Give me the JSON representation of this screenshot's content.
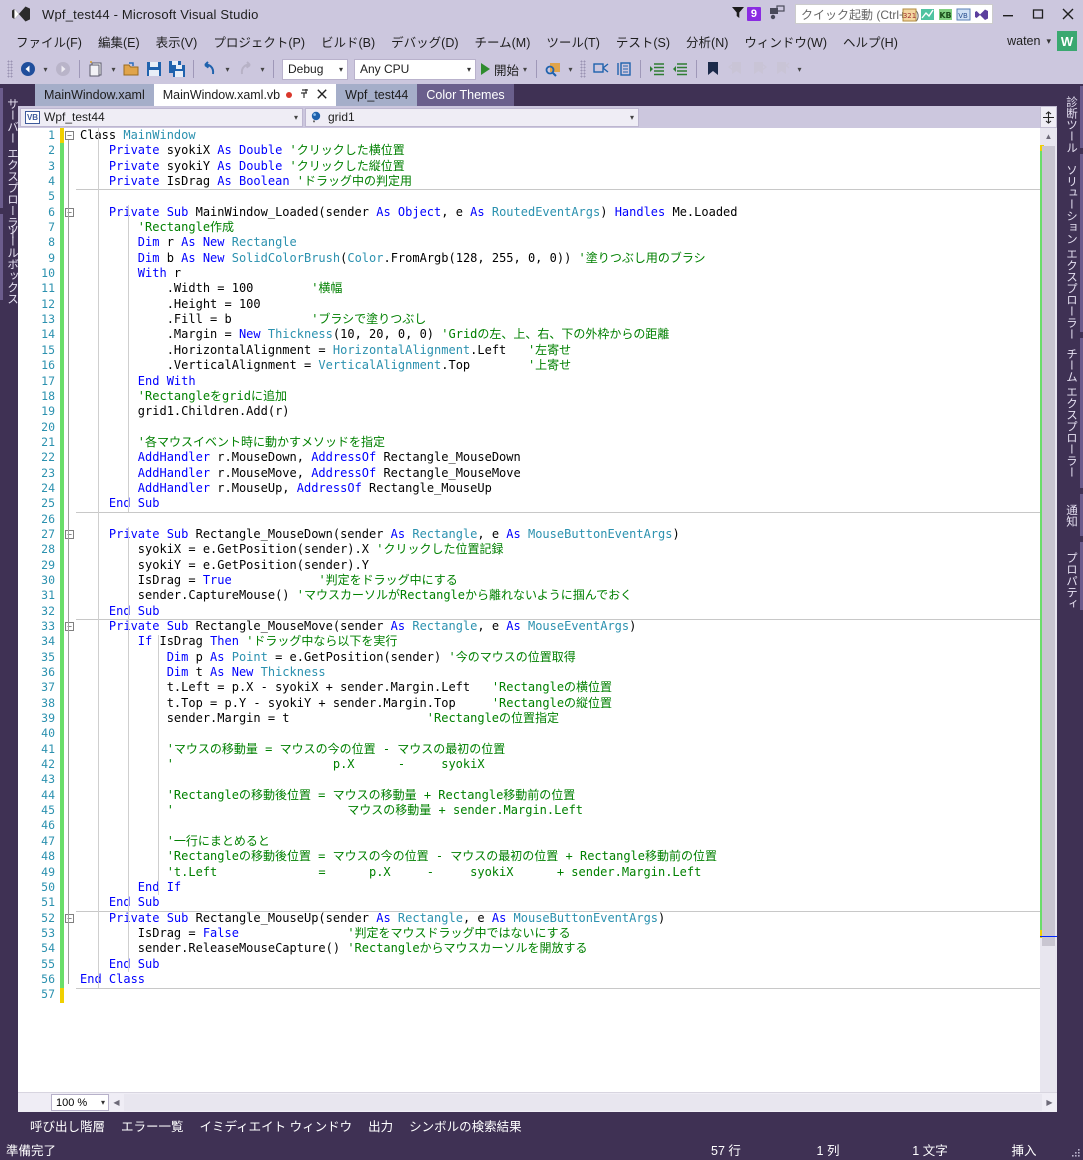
{
  "window": {
    "title": "Wpf_test44 - Microsoft Visual Studio",
    "logo_icon": "visual-studio-logo-icon",
    "minimize_icon": "minimize-icon",
    "maximize_icon": "maximize-icon",
    "close_icon": "close-icon"
  },
  "titlebar_right": {
    "notification_icon": "bell-filter-icon",
    "notification_count": "9",
    "feedback_icon": "feedback-icon",
    "quicklaunch_placeholder": "クイック起動 (Ctrl+Q)",
    "ql_icon_1": "calendar-icon",
    "ql_icon_2": "chart-icon",
    "ql_icon_3": "kb-icon",
    "ql_icon_4": "vb-icon",
    "ql_icon_5": "vs-icon"
  },
  "menu": {
    "items": [
      {
        "label": "ファイル(F)"
      },
      {
        "label": "編集(E)"
      },
      {
        "label": "表示(V)"
      },
      {
        "label": "プロジェクト(P)"
      },
      {
        "label": "ビルド(B)"
      },
      {
        "label": "デバッグ(D)"
      },
      {
        "label": "チーム(M)"
      },
      {
        "label": "ツール(T)"
      },
      {
        "label": "テスト(S)"
      },
      {
        "label": "分析(N)"
      },
      {
        "label": "ウィンドウ(W)"
      },
      {
        "label": "ヘルプ(H)"
      }
    ],
    "user_name": "waten",
    "user_caret": "▾",
    "user_avatar_letter": "W"
  },
  "toolbar": {
    "back_icon": "navigate-back-icon",
    "forward_icon": "navigate-forward-icon",
    "new_project_icon": "new-project-icon",
    "open_icon": "open-file-icon",
    "save_icon": "save-icon",
    "save_all_icon": "save-all-icon",
    "undo_icon": "undo-icon",
    "redo_icon": "redo-icon",
    "config_value": "Debug",
    "platform_value": "Any CPU",
    "start_label": "開始",
    "start_icon": "play-icon",
    "find_icon": "find-in-files-icon",
    "comment_icon": "comment-selection-icon",
    "uncomment_icon": "uncomment-selection-icon",
    "indent_icon": "increase-indent-icon",
    "outdent_icon": "decrease-indent-icon",
    "bookmark_icon": "bookmark-icon",
    "prev_bookmark_icon": "previous-bookmark-icon",
    "next_bookmark_icon": "next-bookmark-icon",
    "clear_bookmark_icon": "clear-bookmark-icon",
    "overflow_icon": "toolbar-overflow-icon",
    "caret": "▾"
  },
  "left_tool_tabs": [
    {
      "label": "サーバー エクスプローラー"
    },
    {
      "label": "ツールボックス"
    }
  ],
  "right_tool_tabs": [
    {
      "label": "診断ツール"
    },
    {
      "label": "ソリューション エクスプローラー"
    },
    {
      "label": "チーム エクスプローラー"
    },
    {
      "label": "通知"
    },
    {
      "label": "プロパティ"
    }
  ],
  "doc_tabs": [
    {
      "label": "MainWindow.xaml",
      "state": "inactive"
    },
    {
      "label": "MainWindow.xaml.vb",
      "state": "active",
      "dirty": true,
      "pin_icon": "pin-icon",
      "close_icon": "tab-close-icon"
    },
    {
      "label": "Wpf_test44",
      "state": "inactive"
    },
    {
      "label": "Color Themes",
      "state": "preview"
    }
  ],
  "navbar": {
    "type_icon": "vb-class-icon",
    "type_value": "Wpf_test44",
    "member_icon": "field-icon",
    "member_value": "grid1",
    "caret": "▾"
  },
  "editor": {
    "zoom": "100 %",
    "zoom_caret": "▾",
    "splitter_icon": "split-view-icon",
    "scroll_up_icon": "scroll-up-icon",
    "scroll_left_icon": "scroll-left-icon",
    "scroll_right_icon": "scroll-right-icon",
    "language": "vb",
    "lines": [
      {
        "n": 1,
        "t": [
          [
            "pl",
            "Class "
          ],
          [
            "ty",
            "MainWindow"
          ]
        ],
        "indent": 0
      },
      {
        "n": 2,
        "t": [
          [
            "kw",
            "    Private "
          ],
          [
            "pl",
            "syokiX "
          ],
          [
            "kw",
            "As "
          ],
          [
            "kw",
            "Double "
          ],
          [
            "cm",
            "'クリックした横位置"
          ]
        ]
      },
      {
        "n": 3,
        "t": [
          [
            "kw",
            "    Private "
          ],
          [
            "pl",
            "syokiY "
          ],
          [
            "kw",
            "As "
          ],
          [
            "kw",
            "Double "
          ],
          [
            "cm",
            "'クリックした縦位置"
          ]
        ]
      },
      {
        "n": 4,
        "t": [
          [
            "kw",
            "    Private "
          ],
          [
            "pl",
            "IsDrag "
          ],
          [
            "kw",
            "As "
          ],
          [
            "kw",
            "Boolean "
          ],
          [
            "cm",
            "'ドラッグ中の判定用"
          ]
        ]
      },
      {
        "n": 5,
        "t": []
      },
      {
        "n": 6,
        "t": [
          [
            "kw",
            "    Private Sub "
          ],
          [
            "pl",
            "MainWindow_Loaded(sender "
          ],
          [
            "kw",
            "As "
          ],
          [
            "kw",
            "Object"
          ],
          [
            "pl",
            ", e "
          ],
          [
            "kw",
            "As "
          ],
          [
            "ty",
            "RoutedEventArgs"
          ],
          [
            "pl",
            ") "
          ],
          [
            "kw",
            "Handles "
          ],
          [
            "pl",
            "Me.Loaded"
          ]
        ]
      },
      {
        "n": 7,
        "t": [
          [
            "cm",
            "        'Rectangle作成"
          ]
        ]
      },
      {
        "n": 8,
        "t": [
          [
            "kw",
            "        Dim "
          ],
          [
            "pl",
            "r "
          ],
          [
            "kw",
            "As New "
          ],
          [
            "ty",
            "Rectangle"
          ]
        ]
      },
      {
        "n": 9,
        "t": [
          [
            "kw",
            "        Dim "
          ],
          [
            "pl",
            "b "
          ],
          [
            "kw",
            "As New "
          ],
          [
            "ty",
            "SolidColorBrush"
          ],
          [
            "pl",
            "("
          ],
          [
            "ty",
            "Color"
          ],
          [
            "pl",
            ".FromArgb(128, 255, 0, 0)) "
          ],
          [
            "cm",
            "'塗りつぶし用のブラシ"
          ]
        ]
      },
      {
        "n": 10,
        "t": [
          [
            "kw",
            "        With "
          ],
          [
            "pl",
            "r"
          ]
        ]
      },
      {
        "n": 11,
        "t": [
          [
            "pl",
            "            .Width = 100        "
          ],
          [
            "cm",
            "'横幅"
          ]
        ]
      },
      {
        "n": 12,
        "t": [
          [
            "pl",
            "            .Height = 100"
          ]
        ]
      },
      {
        "n": 13,
        "t": [
          [
            "pl",
            "            .Fill = b           "
          ],
          [
            "cm",
            "'ブラシで塗りつぶし"
          ]
        ]
      },
      {
        "n": 14,
        "t": [
          [
            "pl",
            "            .Margin = "
          ],
          [
            "kw",
            "New "
          ],
          [
            "ty",
            "Thickness"
          ],
          [
            "pl",
            "(10, 20, 0, 0) "
          ],
          [
            "cm",
            "'Gridの左、上、右、下の外枠からの距離"
          ]
        ]
      },
      {
        "n": 15,
        "t": [
          [
            "pl",
            "            .HorizontalAlignment = "
          ],
          [
            "ty",
            "HorizontalAlignment"
          ],
          [
            "pl",
            ".Left   "
          ],
          [
            "cm",
            "'左寄せ"
          ]
        ]
      },
      {
        "n": 16,
        "t": [
          [
            "pl",
            "            .VerticalAlignment = "
          ],
          [
            "ty",
            "VerticalAlignment"
          ],
          [
            "pl",
            ".Top        "
          ],
          [
            "cm",
            "'上寄せ"
          ]
        ]
      },
      {
        "n": 17,
        "t": [
          [
            "kw",
            "        End With"
          ]
        ]
      },
      {
        "n": 18,
        "t": [
          [
            "cm",
            "        'Rectangleをgridに追加"
          ]
        ]
      },
      {
        "n": 19,
        "t": [
          [
            "pl",
            "        grid1.Children.Add(r)"
          ]
        ]
      },
      {
        "n": 20,
        "t": []
      },
      {
        "n": 21,
        "t": [
          [
            "cm",
            "        '各マウスイベント時に動かすメソッドを指定"
          ]
        ]
      },
      {
        "n": 22,
        "t": [
          [
            "kw",
            "        AddHandler "
          ],
          [
            "pl",
            "r.MouseDown, "
          ],
          [
            "kw",
            "AddressOf "
          ],
          [
            "pl",
            "Rectangle_MouseDown"
          ]
        ]
      },
      {
        "n": 23,
        "t": [
          [
            "kw",
            "        AddHandler "
          ],
          [
            "pl",
            "r.MouseMove, "
          ],
          [
            "kw",
            "AddressOf "
          ],
          [
            "pl",
            "Rectangle_MouseMove"
          ]
        ]
      },
      {
        "n": 24,
        "t": [
          [
            "kw",
            "        AddHandler "
          ],
          [
            "pl",
            "r.MouseUp, "
          ],
          [
            "kw",
            "AddressOf "
          ],
          [
            "pl",
            "Rectangle_MouseUp"
          ]
        ]
      },
      {
        "n": 25,
        "t": [
          [
            "kw",
            "    End Sub"
          ]
        ]
      },
      {
        "n": 26,
        "t": []
      },
      {
        "n": 27,
        "t": [
          [
            "kw",
            "    Private Sub "
          ],
          [
            "pl",
            "Rectangle_MouseDown(sender "
          ],
          [
            "kw",
            "As "
          ],
          [
            "ty",
            "Rectangle"
          ],
          [
            "pl",
            ", e "
          ],
          [
            "kw",
            "As "
          ],
          [
            "ty",
            "MouseButtonEventArgs"
          ],
          [
            "pl",
            ")"
          ]
        ]
      },
      {
        "n": 28,
        "t": [
          [
            "pl",
            "        syokiX = e.GetPosition(sender).X "
          ],
          [
            "cm",
            "'クリックした位置記録"
          ]
        ]
      },
      {
        "n": 29,
        "t": [
          [
            "pl",
            "        syokiY = e.GetPosition(sender).Y"
          ]
        ]
      },
      {
        "n": 30,
        "t": [
          [
            "pl",
            "        IsDrag = "
          ],
          [
            "kw",
            "True"
          ],
          [
            "pl",
            "            "
          ],
          [
            "cm",
            "'判定をドラッグ中にする"
          ]
        ]
      },
      {
        "n": 31,
        "t": [
          [
            "pl",
            "        sender.CaptureMouse() "
          ],
          [
            "cm",
            "'マウスカーソルがRectangleから離れないように掴んでおく"
          ]
        ]
      },
      {
        "n": 32,
        "t": [
          [
            "kw",
            "    End Sub"
          ]
        ]
      },
      {
        "n": 33,
        "t": [
          [
            "kw",
            "    Private Sub "
          ],
          [
            "pl",
            "Rectangle_MouseMove(sender "
          ],
          [
            "kw",
            "As "
          ],
          [
            "ty",
            "Rectangle"
          ],
          [
            "pl",
            ", e "
          ],
          [
            "kw",
            "As "
          ],
          [
            "ty",
            "MouseEventArgs"
          ],
          [
            "pl",
            ")"
          ]
        ]
      },
      {
        "n": 34,
        "t": [
          [
            "kw",
            "        If "
          ],
          [
            "pl",
            "IsDrag "
          ],
          [
            "kw",
            "Then "
          ],
          [
            "cm",
            "'ドラッグ中なら以下を実行"
          ]
        ]
      },
      {
        "n": 35,
        "t": [
          [
            "kw",
            "            Dim "
          ],
          [
            "pl",
            "p "
          ],
          [
            "kw",
            "As "
          ],
          [
            "ty",
            "Point"
          ],
          [
            "pl",
            " = e.GetPosition(sender) "
          ],
          [
            "cm",
            "'今のマウスの位置取得"
          ]
        ]
      },
      {
        "n": 36,
        "t": [
          [
            "kw",
            "            Dim "
          ],
          [
            "pl",
            "t "
          ],
          [
            "kw",
            "As New "
          ],
          [
            "ty",
            "Thickness"
          ]
        ]
      },
      {
        "n": 37,
        "t": [
          [
            "pl",
            "            t.Left = p.X - syokiX + sender.Margin.Left   "
          ],
          [
            "cm",
            "'Rectangleの横位置"
          ]
        ]
      },
      {
        "n": 38,
        "t": [
          [
            "pl",
            "            t.Top = p.Y - syokiY + sender.Margin.Top     "
          ],
          [
            "cm",
            "'Rectangleの縦位置"
          ]
        ]
      },
      {
        "n": 39,
        "t": [
          [
            "pl",
            "            sender.Margin = t                   "
          ],
          [
            "cm",
            "'Rectangleの位置指定"
          ]
        ]
      },
      {
        "n": 40,
        "t": []
      },
      {
        "n": 41,
        "t": [
          [
            "cm",
            "            'マウスの移動量 = マウスの今の位置 - マウスの最初の位置"
          ]
        ]
      },
      {
        "n": 42,
        "t": [
          [
            "cm",
            "            '                      p.X      -     syokiX"
          ]
        ]
      },
      {
        "n": 43,
        "t": []
      },
      {
        "n": 44,
        "t": [
          [
            "cm",
            "            'Rectangleの移動後位置 = マウスの移動量 + Rectangle移動前の位置"
          ]
        ]
      },
      {
        "n": 45,
        "t": [
          [
            "cm",
            "            '                        マウスの移動量 + sender.Margin.Left"
          ]
        ]
      },
      {
        "n": 46,
        "t": []
      },
      {
        "n": 47,
        "t": [
          [
            "cm",
            "            '一行にまとめると"
          ]
        ]
      },
      {
        "n": 48,
        "t": [
          [
            "cm",
            "            'Rectangleの移動後位置 = マウスの今の位置 - マウスの最初の位置 + Rectangle移動前の位置"
          ]
        ]
      },
      {
        "n": 49,
        "t": [
          [
            "cm",
            "            't.Left              =      p.X     -     syokiX      + sender.Margin.Left"
          ]
        ]
      },
      {
        "n": 50,
        "t": [
          [
            "kw",
            "        End If"
          ]
        ]
      },
      {
        "n": 51,
        "t": [
          [
            "kw",
            "    End Sub"
          ]
        ]
      },
      {
        "n": 52,
        "t": [
          [
            "kw",
            "    Private Sub "
          ],
          [
            "pl",
            "Rectangle_MouseUp(sender "
          ],
          [
            "kw",
            "As "
          ],
          [
            "ty",
            "Rectangle"
          ],
          [
            "pl",
            ", e "
          ],
          [
            "kw",
            "As "
          ],
          [
            "ty",
            "MouseButtonEventArgs"
          ],
          [
            "pl",
            ")"
          ]
        ]
      },
      {
        "n": 53,
        "t": [
          [
            "pl",
            "        IsDrag = "
          ],
          [
            "kw",
            "False"
          ],
          [
            "pl",
            "               "
          ],
          [
            "cm",
            "'判定をマウスドラッグ中ではないにする"
          ]
        ]
      },
      {
        "n": 54,
        "t": [
          [
            "pl",
            "        sender.ReleaseMouseCapture() "
          ],
          [
            "cm",
            "'Rectangleからマウスカーソルを開放する"
          ]
        ]
      },
      {
        "n": 55,
        "t": [
          [
            "kw",
            "    End Sub"
          ]
        ]
      },
      {
        "n": 56,
        "t": [
          [
            "kw",
            "End Class"
          ]
        ]
      },
      {
        "n": 57,
        "t": []
      }
    ]
  },
  "bottom_tabs": [
    {
      "label": "呼び出し階層"
    },
    {
      "label": "エラー一覧"
    },
    {
      "label": "イミディエイト ウィンドウ"
    },
    {
      "label": "出力"
    },
    {
      "label": "シンボルの検索結果"
    }
  ],
  "status": {
    "ready": "準備完了",
    "line": "57 行",
    "column": "1 列",
    "character": "1 文字",
    "insert_mode": "挿入",
    "resizer_icon": "resize-grip-icon"
  },
  "colors": {
    "chrome": "#ccc7de",
    "shell_dark": "#3f3154",
    "accent_purple": "#6b5c8c",
    "keyword_blue": "#0000ff",
    "type_teal": "#2b91af",
    "comment_green": "#008000",
    "change_bar_green": "#6ade6a",
    "change_bar_yellow": "#f0d000",
    "dirty_red": "#d9372b",
    "avatar_green": "#3aa870",
    "badge_purple": "#8a2be2"
  }
}
